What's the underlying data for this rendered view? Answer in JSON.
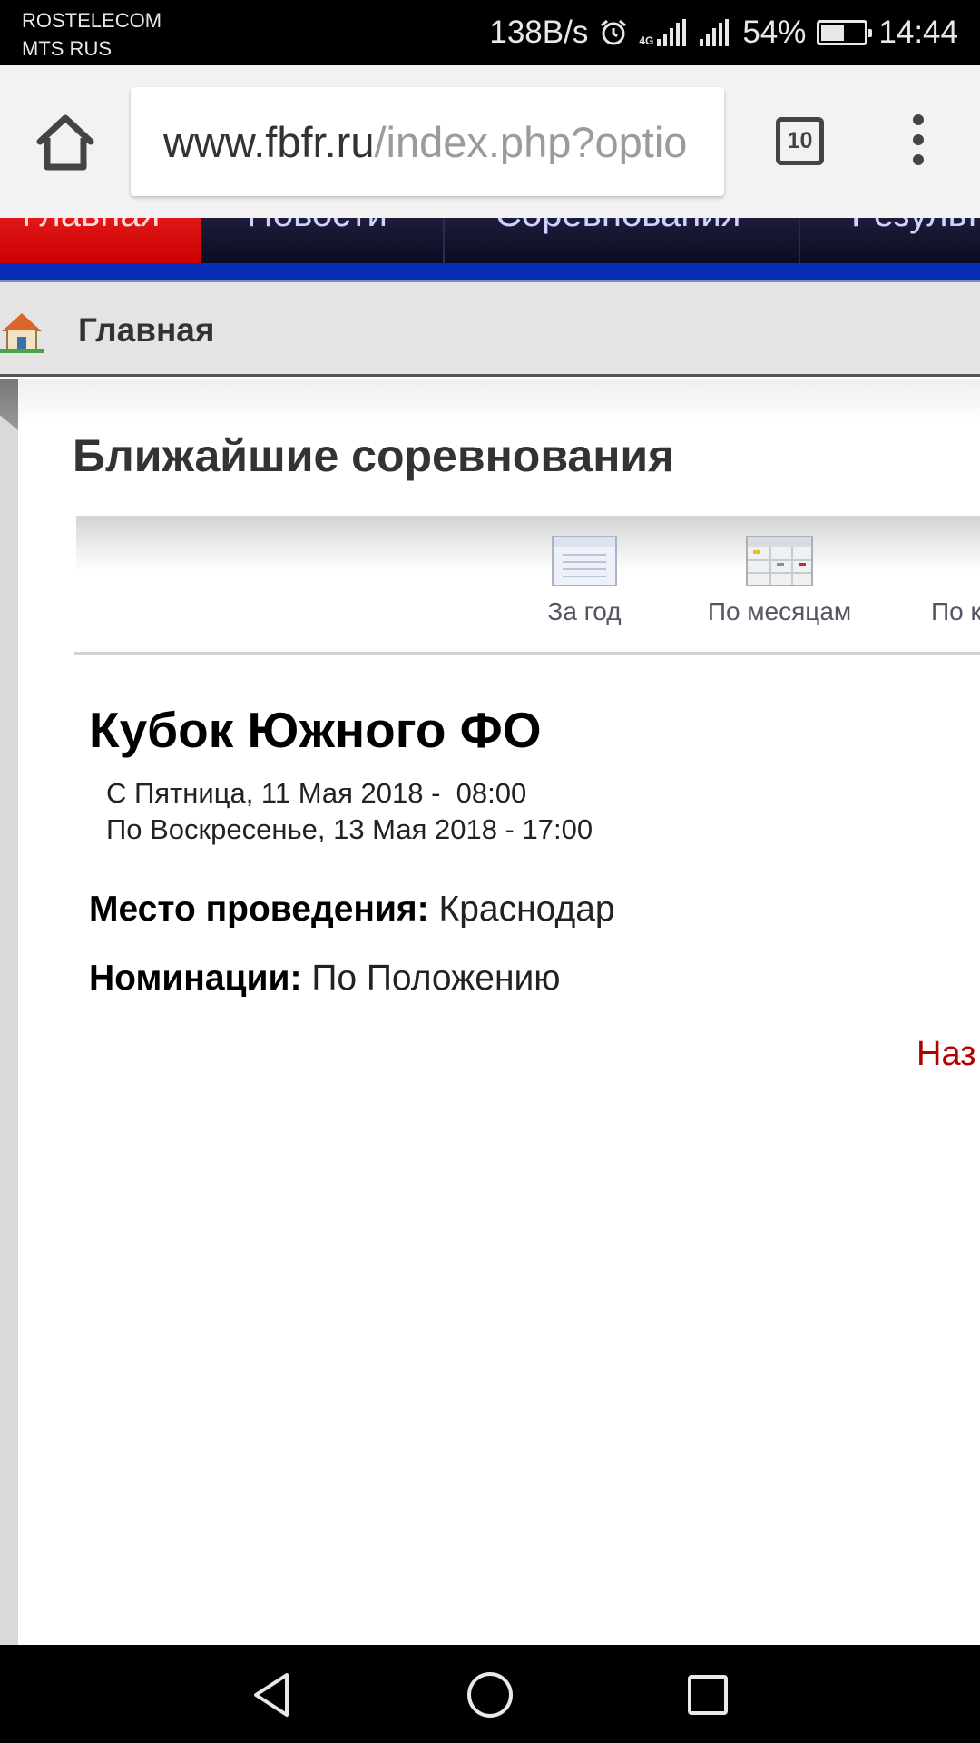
{
  "status_bar": {
    "carrier_1": "ROSTELECOM",
    "carrier_2": "MTS RUS",
    "net_speed": "138B/s",
    "network_type": "4G",
    "battery_percent": "54%",
    "battery_level": 0.54,
    "time": "14:44",
    "alarm_icon": "alarm-clock-icon"
  },
  "browser": {
    "url_host": "www.fbfr.ru",
    "url_path": "/index.php?optio",
    "tab_count": "10",
    "home_icon": "home-icon",
    "menu_icon": "overflow-menu-icon"
  },
  "site": {
    "nav_items": [
      "Главная",
      "Новости",
      "Соревнования",
      "Результаты"
    ],
    "active_nav_color": "#dd1111",
    "breadcrumb": "Главная",
    "section_title": "Ближайшие соревнования",
    "view_options": [
      {
        "label": "За год",
        "icon": "year-list-icon"
      },
      {
        "label": "По месяцам",
        "icon": "month-calendar-icon"
      },
      {
        "label": "По к",
        "icon": "category-icon"
      }
    ],
    "event": {
      "title": "Кубок Южного ФО",
      "date_from": "С Пятница, 11 Мая 2018 -  08:00",
      "date_to": "По Воскресенье, 13 Мая 2018 - 17:00",
      "venue_label": "Место проведения:",
      "venue_value": "Краснодар",
      "nominations_label": "Номинации:",
      "nominations_value": "По Положению"
    },
    "back_link": "Наз"
  },
  "system_nav": {
    "back_icon": "back-triangle-icon",
    "home_icon": "home-circle-icon",
    "recents_icon": "recents-square-icon"
  }
}
